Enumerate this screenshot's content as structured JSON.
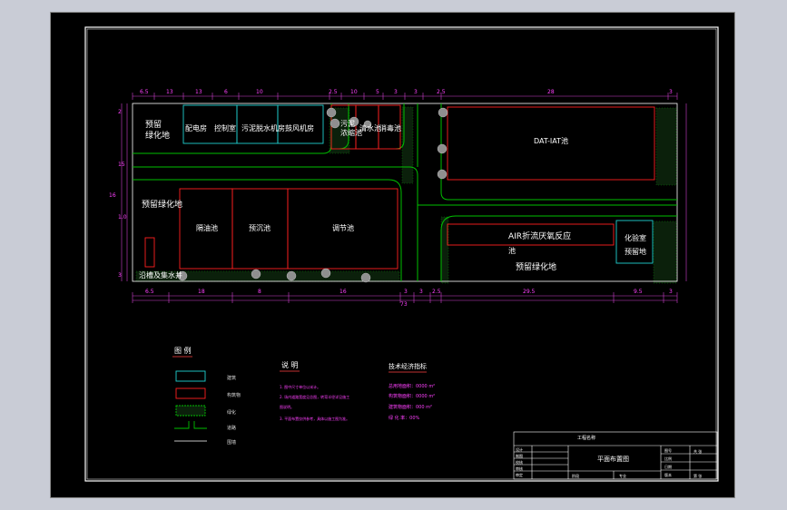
{
  "colors": {
    "background": "#c9ccd6",
    "sheet": "#000000",
    "frame": "#ffffff",
    "road": "#00c000",
    "tank": "#ff2020",
    "building": "#20d0d0",
    "dimension": "#d040d0",
    "tree": "#9a9a9a",
    "text_magenta": "#ff40ff"
  },
  "plan": {
    "upper_left": {
      "green_area": "预留\n绿化地",
      "rooms": [
        "配电房",
        "控制室",
        "污泥脱水机房",
        "鼓风机房"
      ],
      "sludge": "污泥\n浓缩池",
      "clear_water": "清水池",
      "disinfection": "消毒池"
    },
    "upper_right": {
      "tank": "DAT-IAT池"
    },
    "lower_left": {
      "green_area": "预留绿化地",
      "tanks": [
        "隔油池",
        "预沉池",
        "调节池"
      ],
      "collect": "沿槽及集水井"
    },
    "lower_right": {
      "main_tank": "AIR折流厌氧反应",
      "main_tank_suffix": "池",
      "lab": "化验室\n预留地",
      "green_area": "预留绿化地"
    },
    "dims_top": [
      "6.5",
      "13",
      "13",
      "6",
      "10",
      "2.5",
      "10",
      "5",
      "3",
      "3",
      "2.5",
      "28",
      "3"
    ],
    "dims_bottom": [
      "6.5",
      "18",
      "8",
      "16",
      "3",
      "3",
      "2.5",
      "29.5",
      "9.5",
      "3"
    ],
    "total_width": "73",
    "dims_left": [
      "2",
      "15",
      "16",
      "1.0",
      "3"
    ]
  },
  "legend": {
    "title": "图  例",
    "items": [
      {
        "key": "building",
        "label": "建筑"
      },
      {
        "key": "tank",
        "label": "构筑物"
      },
      {
        "key": "green",
        "label": "绿化"
      },
      {
        "key": "road",
        "label": "道路"
      },
      {
        "key": "line",
        "label": "围墙"
      }
    ]
  },
  "notes": {
    "title": "说  明",
    "lines": [
      "1. 图中尺寸单位以米计。",
      "2. 场内道路宽度见总图，转弯半径详见施工",
      "   图说明。",
      "3. 平面布置仅供参考，具体以施工图为准。"
    ]
  },
  "tech": {
    "title": "技术经济指标",
    "lines": [
      "总用地面积：0000 m²",
      "构筑物面积：0000 m²",
      "建筑物面积：000 m²",
      "绿  化  率：00%"
    ]
  },
  "title_block": {
    "drawing_name": "平面布置图",
    "top_cell": "工程名称",
    "left_rows": [
      "设计",
      "制图",
      "校核",
      "审核",
      "审定"
    ],
    "right_rows": [
      "图号",
      "比例",
      "日期",
      "版本"
    ],
    "bottom": [
      "阶段",
      "专业",
      "共 张",
      "第 张"
    ]
  }
}
